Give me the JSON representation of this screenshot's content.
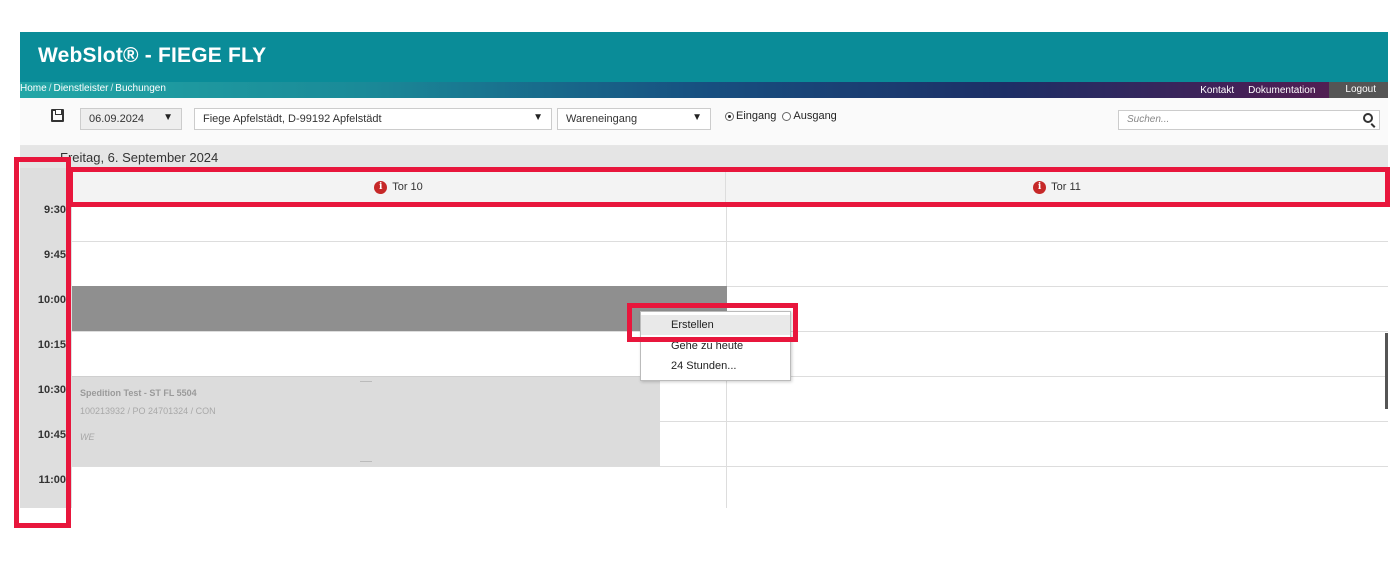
{
  "app": {
    "title": "WebSlot® - FIEGE FLY"
  },
  "nav": {
    "breadcrumb": [
      "Home",
      "Dienstleister",
      "Buchungen"
    ],
    "links": [
      "Kontakt",
      "Dokumentation"
    ],
    "logout": "Logout"
  },
  "toolbar": {
    "save_icon": "save-icon",
    "date": "06.09.2024",
    "location": "Fiege Apfelstädt, D-99192 Apfelstädt",
    "type": "Wareneingang",
    "direction_options": [
      "Eingang",
      "Ausgang"
    ],
    "direction_selected": "Eingang",
    "search_placeholder": "Suchen..."
  },
  "calendar": {
    "day_title": "Freitag, 6. September 2024",
    "gates": [
      "Tor 10",
      "Tor 11"
    ],
    "times": [
      "9:30",
      "9:45",
      "10:00",
      "10:15",
      "10:30",
      "10:45",
      "11:00"
    ],
    "booking": {
      "title": "Spedition Test - ST FL 5504",
      "reference": "100213932 / PO 24701324 / CON",
      "type": "WE"
    }
  },
  "context_menu": {
    "items": [
      "Erstellen",
      "Gehe zu heute",
      "24 Stunden..."
    ],
    "active": "Erstellen"
  },
  "colors": {
    "header": "#0a8c98",
    "highlight": "#e8163c",
    "selection": "#8f8f8f",
    "booking": "#dcdcdc"
  }
}
